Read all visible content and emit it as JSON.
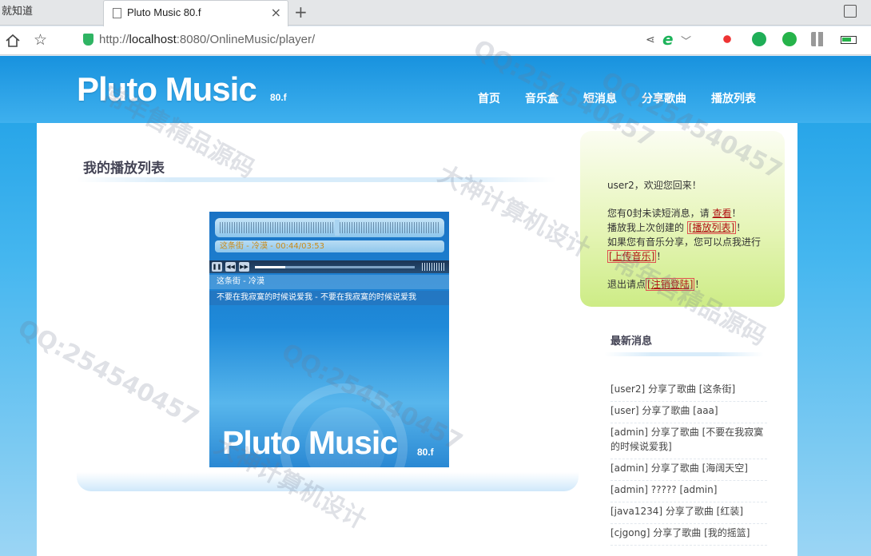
{
  "browser": {
    "prev_tab_label": "就知道",
    "tab_title": "Pluto Music 80.f",
    "tab_close": "×",
    "new_tab": "+",
    "url_prefix": "http://",
    "url_host": "localhost",
    "url_rest": ":8080/OnlineMusic/player/"
  },
  "header": {
    "logo": "Pluto Music",
    "logo_version": "80.f",
    "nav": [
      "首页",
      "音乐盒",
      "短消息",
      "分享歌曲",
      "播放列表"
    ]
  },
  "main": {
    "title": "我的播放列表"
  },
  "player": {
    "now_playing": "这条街 - 冷漠 - 00:44/03:53",
    "progress": 0.19,
    "playlist": [
      "这条街 - 冷漠",
      "不要在我寂寞的时候说爱我 - 不要在我寂寞的时候说爱我"
    ],
    "logo": "Pluto Music",
    "logo_version": "80.f"
  },
  "welcome": {
    "greeting": "user2，欢迎您回来！",
    "msg_prefix": "您有0封未读短消息，请",
    "msg_link": "查看",
    "msg_suffix": "！",
    "playlist_prefix": "播放我上次创建的",
    "playlist_link": "[播放列表]",
    "playlist_suffix": "！",
    "share_text": "如果您有音乐分享，您可以点我进行",
    "upload_link": "[上传音乐]",
    "upload_suffix": "！",
    "logout_prefix": "退出请点",
    "logout_link": "[注销登陆]",
    "logout_suffix": "！"
  },
  "news": {
    "title": "最新消息",
    "items": [
      "[user2] 分享了歌曲 [这条街]",
      "[user] 分享了歌曲 [aaa]",
      "[admin]  分享了歌曲  [不要在我寂寞的时候说爱我]",
      "[admin] 分享了歌曲 [海阔天空]",
      "[admin] ????? [admin]",
      "[java1234] 分享了歌曲 [红装]",
      "[cjgong] 分享了歌曲 [我的摇篮]"
    ]
  },
  "watermark": [
    "QQ:254540457",
    "常年售精品源码",
    "大神计算机设计"
  ]
}
